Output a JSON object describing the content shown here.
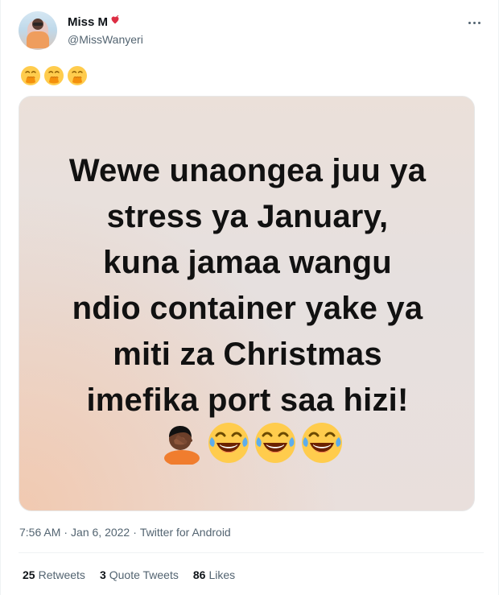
{
  "user": {
    "display_name": "Miss M",
    "handle": "@MissWanyeri"
  },
  "icons": {
    "avatar": "profile-photo",
    "verified_heart": "heart-emoji",
    "more": "ellipsis-icon",
    "tweet_emojis": [
      "hand-over-mouth-emoji",
      "hand-over-mouth-emoji",
      "hand-over-mouth-emoji"
    ],
    "media_emojis": [
      "facepalm-emoji",
      "laughing-tears-emoji",
      "laughing-tears-emoji",
      "laughing-tears-emoji"
    ]
  },
  "media": {
    "lines": [
      "Wewe unaongea juu ya",
      "stress ya January,",
      "kuna jamaa wangu",
      "ndio container yake ya",
      "miti za Christmas",
      "imefika port saa hizi!"
    ]
  },
  "meta": {
    "time": "7:56 AM",
    "date": "Jan 6, 2022",
    "source": "Twitter for Android"
  },
  "stats": {
    "retweets_count": "25",
    "retweets_label": "Retweets",
    "quotes_count": "3",
    "quotes_label": "Quote Tweets",
    "likes_count": "86",
    "likes_label": "Likes"
  },
  "colors": {
    "text_primary": "#0f1419",
    "text_secondary": "#536471",
    "divider": "#eff3f4",
    "media_peach": "#f6bc96",
    "emoji_yellow": "#ffcc4d",
    "emoji_orange": "#f4900c",
    "heart_red": "#dd2e44"
  }
}
